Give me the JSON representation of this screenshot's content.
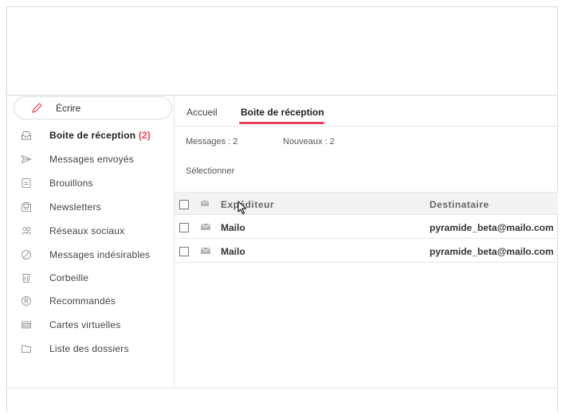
{
  "sidebar": {
    "compose_label": "Écrire",
    "items": [
      {
        "label": "Boite de réception",
        "count": "(2)",
        "icon": "inbox-tray-icon",
        "active": true
      },
      {
        "label": "Messages envoyés",
        "icon": "paper-plane-icon"
      },
      {
        "label": "Brouillons",
        "icon": "draft-document-icon"
      },
      {
        "label": "Newsletters",
        "icon": "newsletter-icon"
      },
      {
        "label": "Réseaux sociaux",
        "icon": "people-icon"
      },
      {
        "label": "Messages indésirables",
        "icon": "spam-block-icon"
      },
      {
        "label": "Corbeille",
        "icon": "trash-icon"
      },
      {
        "label": "Recommandés",
        "icon": "registered-icon"
      },
      {
        "label": "Cartes virtuelles",
        "icon": "virtual-card-icon"
      },
      {
        "label": "Liste des dossiers",
        "icon": "folder-icon"
      }
    ]
  },
  "tabs": [
    {
      "label": "Accueil"
    },
    {
      "label": "Boite de réception",
      "active": true
    }
  ],
  "stats": {
    "messages": "Messages : 2",
    "new": "Nouveaux : 2"
  },
  "select_label": "Sélectionner",
  "table": {
    "columns": [
      "Expéditeur",
      "Destinataire"
    ],
    "rows": [
      {
        "sender": "Mailo",
        "recipient": "pyramide_beta@mailo.com"
      },
      {
        "sender": "Mailo",
        "recipient": "pyramide_beta@mailo.com"
      }
    ]
  },
  "colors": {
    "accent": "#e8425a",
    "icon_gray": "#9a9a9a"
  }
}
